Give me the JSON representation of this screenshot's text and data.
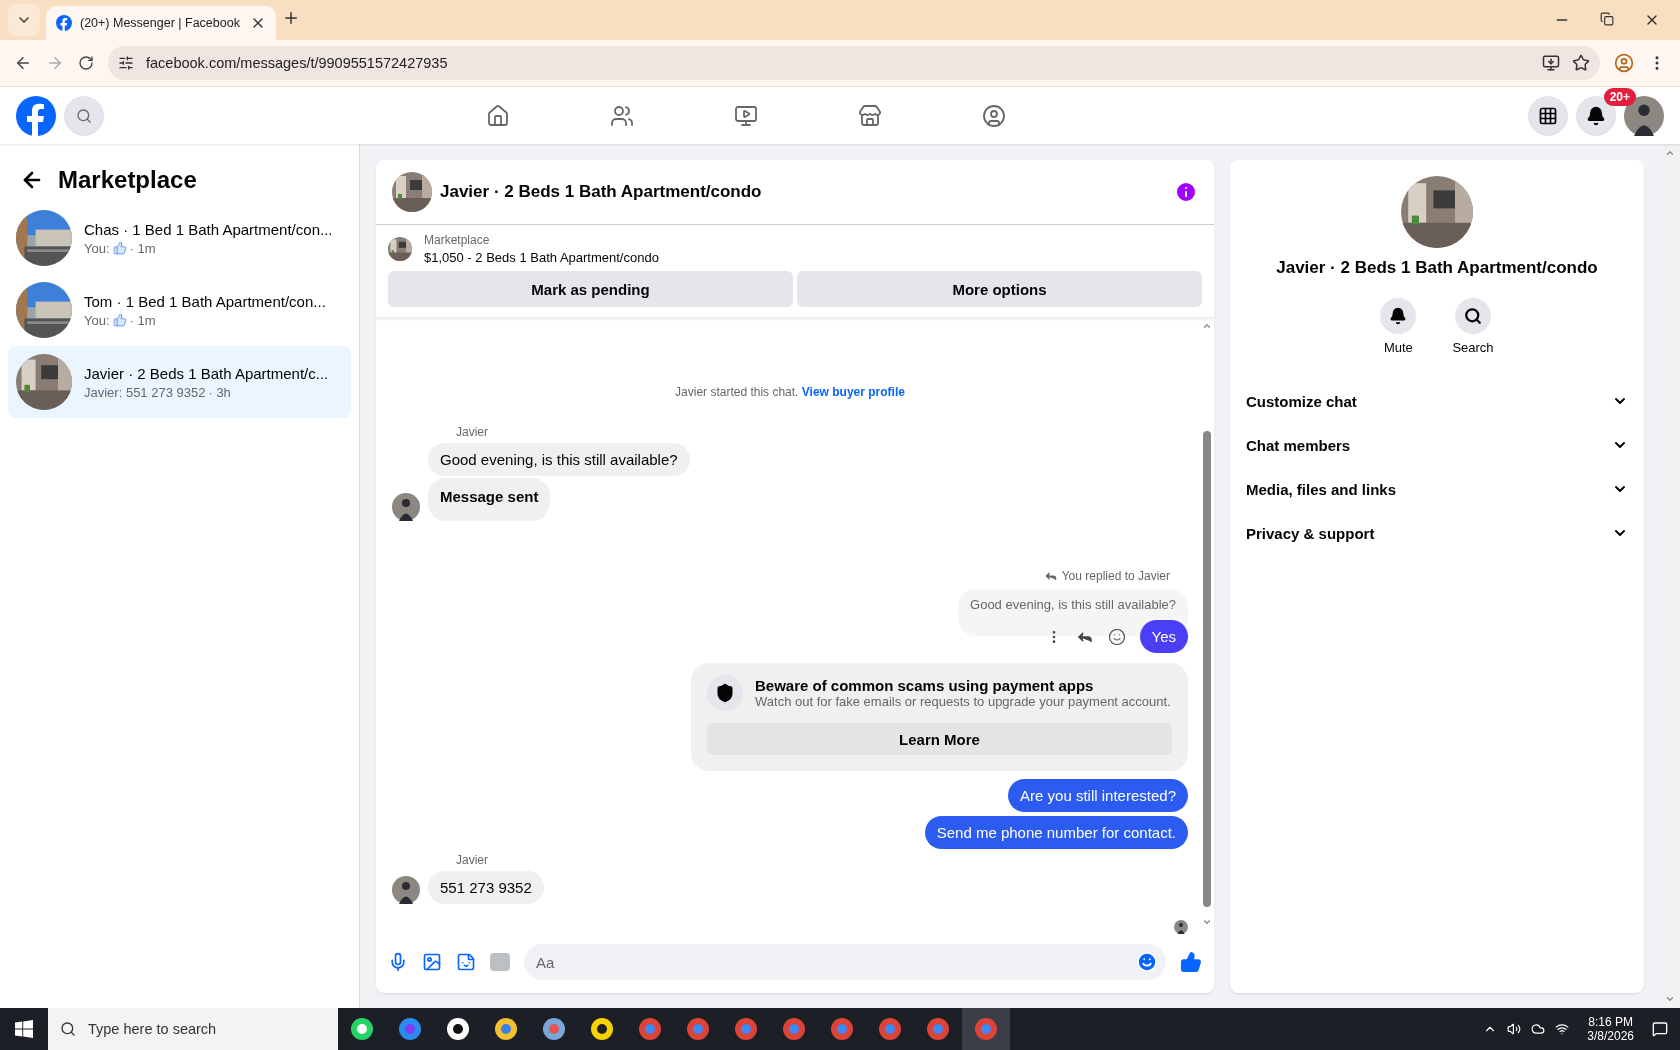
{
  "browser": {
    "tab": {
      "title": "(20+) Messenger | Facebook",
      "selected": true
    },
    "url": "facebook.com/messages/t/9909551572427935"
  },
  "header": {
    "notification_badge": "20+"
  },
  "sidebar": {
    "title": "Marketplace",
    "conversations": [
      {
        "title": "Chas · 1 Bed 1 Bath Apartment/con...",
        "kind": "like",
        "sender": "You:",
        "time": "· 1m",
        "selected": false
      },
      {
        "title": "Tom · 1 Bed 1 Bath Apartment/con...",
        "kind": "like",
        "sender": "You:",
        "time": "· 1m",
        "selected": false
      },
      {
        "title": "Javier · 2 Beds 1 Bath Apartment/c...",
        "kind": "text",
        "sender": "Javier: 551 273 9352",
        "time": "· 3h",
        "selected": true
      }
    ]
  },
  "chat": {
    "title": "Javier · 2 Beds 1 Bath Apartment/condo",
    "listing": {
      "label": "Marketplace",
      "text": "$1,050 - 2 Beds 1 Bath Apartment/condo"
    },
    "actions": [
      "Mark as pending",
      "More options"
    ],
    "system": {
      "text": "Javier started this chat.",
      "link": "View buyer profile"
    },
    "messages": [
      {
        "kind": "incoming",
        "sender": "Javier",
        "bubbles": [
          {
            "text": "Good evening, is this still available?",
            "bold": false
          },
          {
            "text": "Message sent",
            "bold": true
          }
        ]
      },
      {
        "kind": "reply",
        "note": "You replied to Javier",
        "quoted": "Good evening, is this still available?",
        "text": "Yes"
      },
      {
        "kind": "notice",
        "title": "Beware of common scams using payment apps",
        "text": "Watch out for fake emails or requests to upgrade your payment account.",
        "button": "Learn More"
      },
      {
        "kind": "outgoing",
        "text": "Are you still interested?"
      },
      {
        "kind": "outgoing",
        "text": "Send me phone number for contact."
      },
      {
        "kind": "incoming",
        "sender": "Javier",
        "bubbles": [
          {
            "text": "551 273 9352",
            "bold": false
          }
        ]
      }
    ],
    "composer": {
      "placeholder": "Aa"
    }
  },
  "details": {
    "title": "Javier · 2 Beds 1 Bath Apartment/condo",
    "actions": [
      {
        "kind": "mute",
        "label": "Mute"
      },
      {
        "kind": "search",
        "label": "Search"
      }
    ],
    "sections": [
      {
        "label": "Customize chat",
        "expanded": false
      },
      {
        "label": "Chat members",
        "expanded": false
      },
      {
        "label": "Media, files and links",
        "expanded": false
      },
      {
        "label": "Privacy & support",
        "expanded": false
      }
    ]
  },
  "taskbar": {
    "search_placeholder": "Type here to search",
    "time": "8:16 PM",
    "date": "3/8/2026"
  }
}
